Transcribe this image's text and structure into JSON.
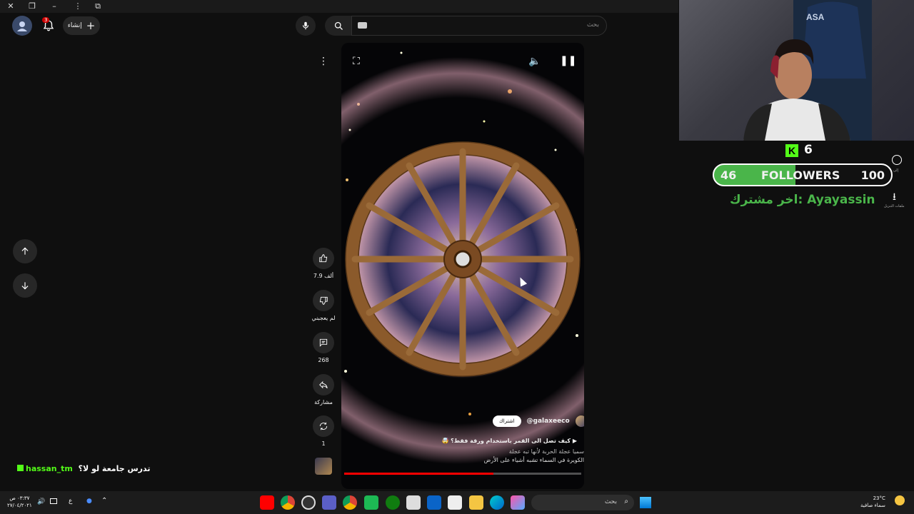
{
  "header": {
    "create_label": "إنشاء",
    "notification_count": "3",
    "search_placeholder": "بحث"
  },
  "video": {
    "channel_handle": "@galaxeeco",
    "subscribe_label": "اشتراك",
    "title": "كيف تصل الى القمر باستخدام ورقة فقط؟ 🤯",
    "description_line1": "سميا عجلة الحربة لأنها تبه عجلة",
    "description_line2": "الكويرة في السماء تشبه أشياء على الأرض",
    "progress_fraction": 0.63
  },
  "actions": {
    "likes": "7.9 ألف",
    "dislike_label": "لم يعجبني",
    "comments": "268",
    "share_label": "مشاركة",
    "remix": "1"
  },
  "chat": {
    "username": "hassan_tm",
    "message": "تدرس جامعة لو لا؟"
  },
  "overlay": {
    "kick_count": "6",
    "followers_current": "46",
    "followers_label": "FOLLOWERS",
    "followers_goal": "100",
    "last_subscriber": "اخر مشترك: Ayayassin",
    "side_label_1": "إلى",
    "side_label_2": "ملفات التنزيل"
  },
  "taskbar": {
    "search_label": "بحث",
    "time": "٠٣:٣٧ ص",
    "date": "٢٧/٠٤/٢٠٢١",
    "lang": "ع",
    "weather_temp": "23°C",
    "weather_desc": "سماء صافية"
  },
  "colors": {
    "accent_red": "#ff0000",
    "kick_green": "#53fc18",
    "followers_fill": "#4ab54a"
  }
}
